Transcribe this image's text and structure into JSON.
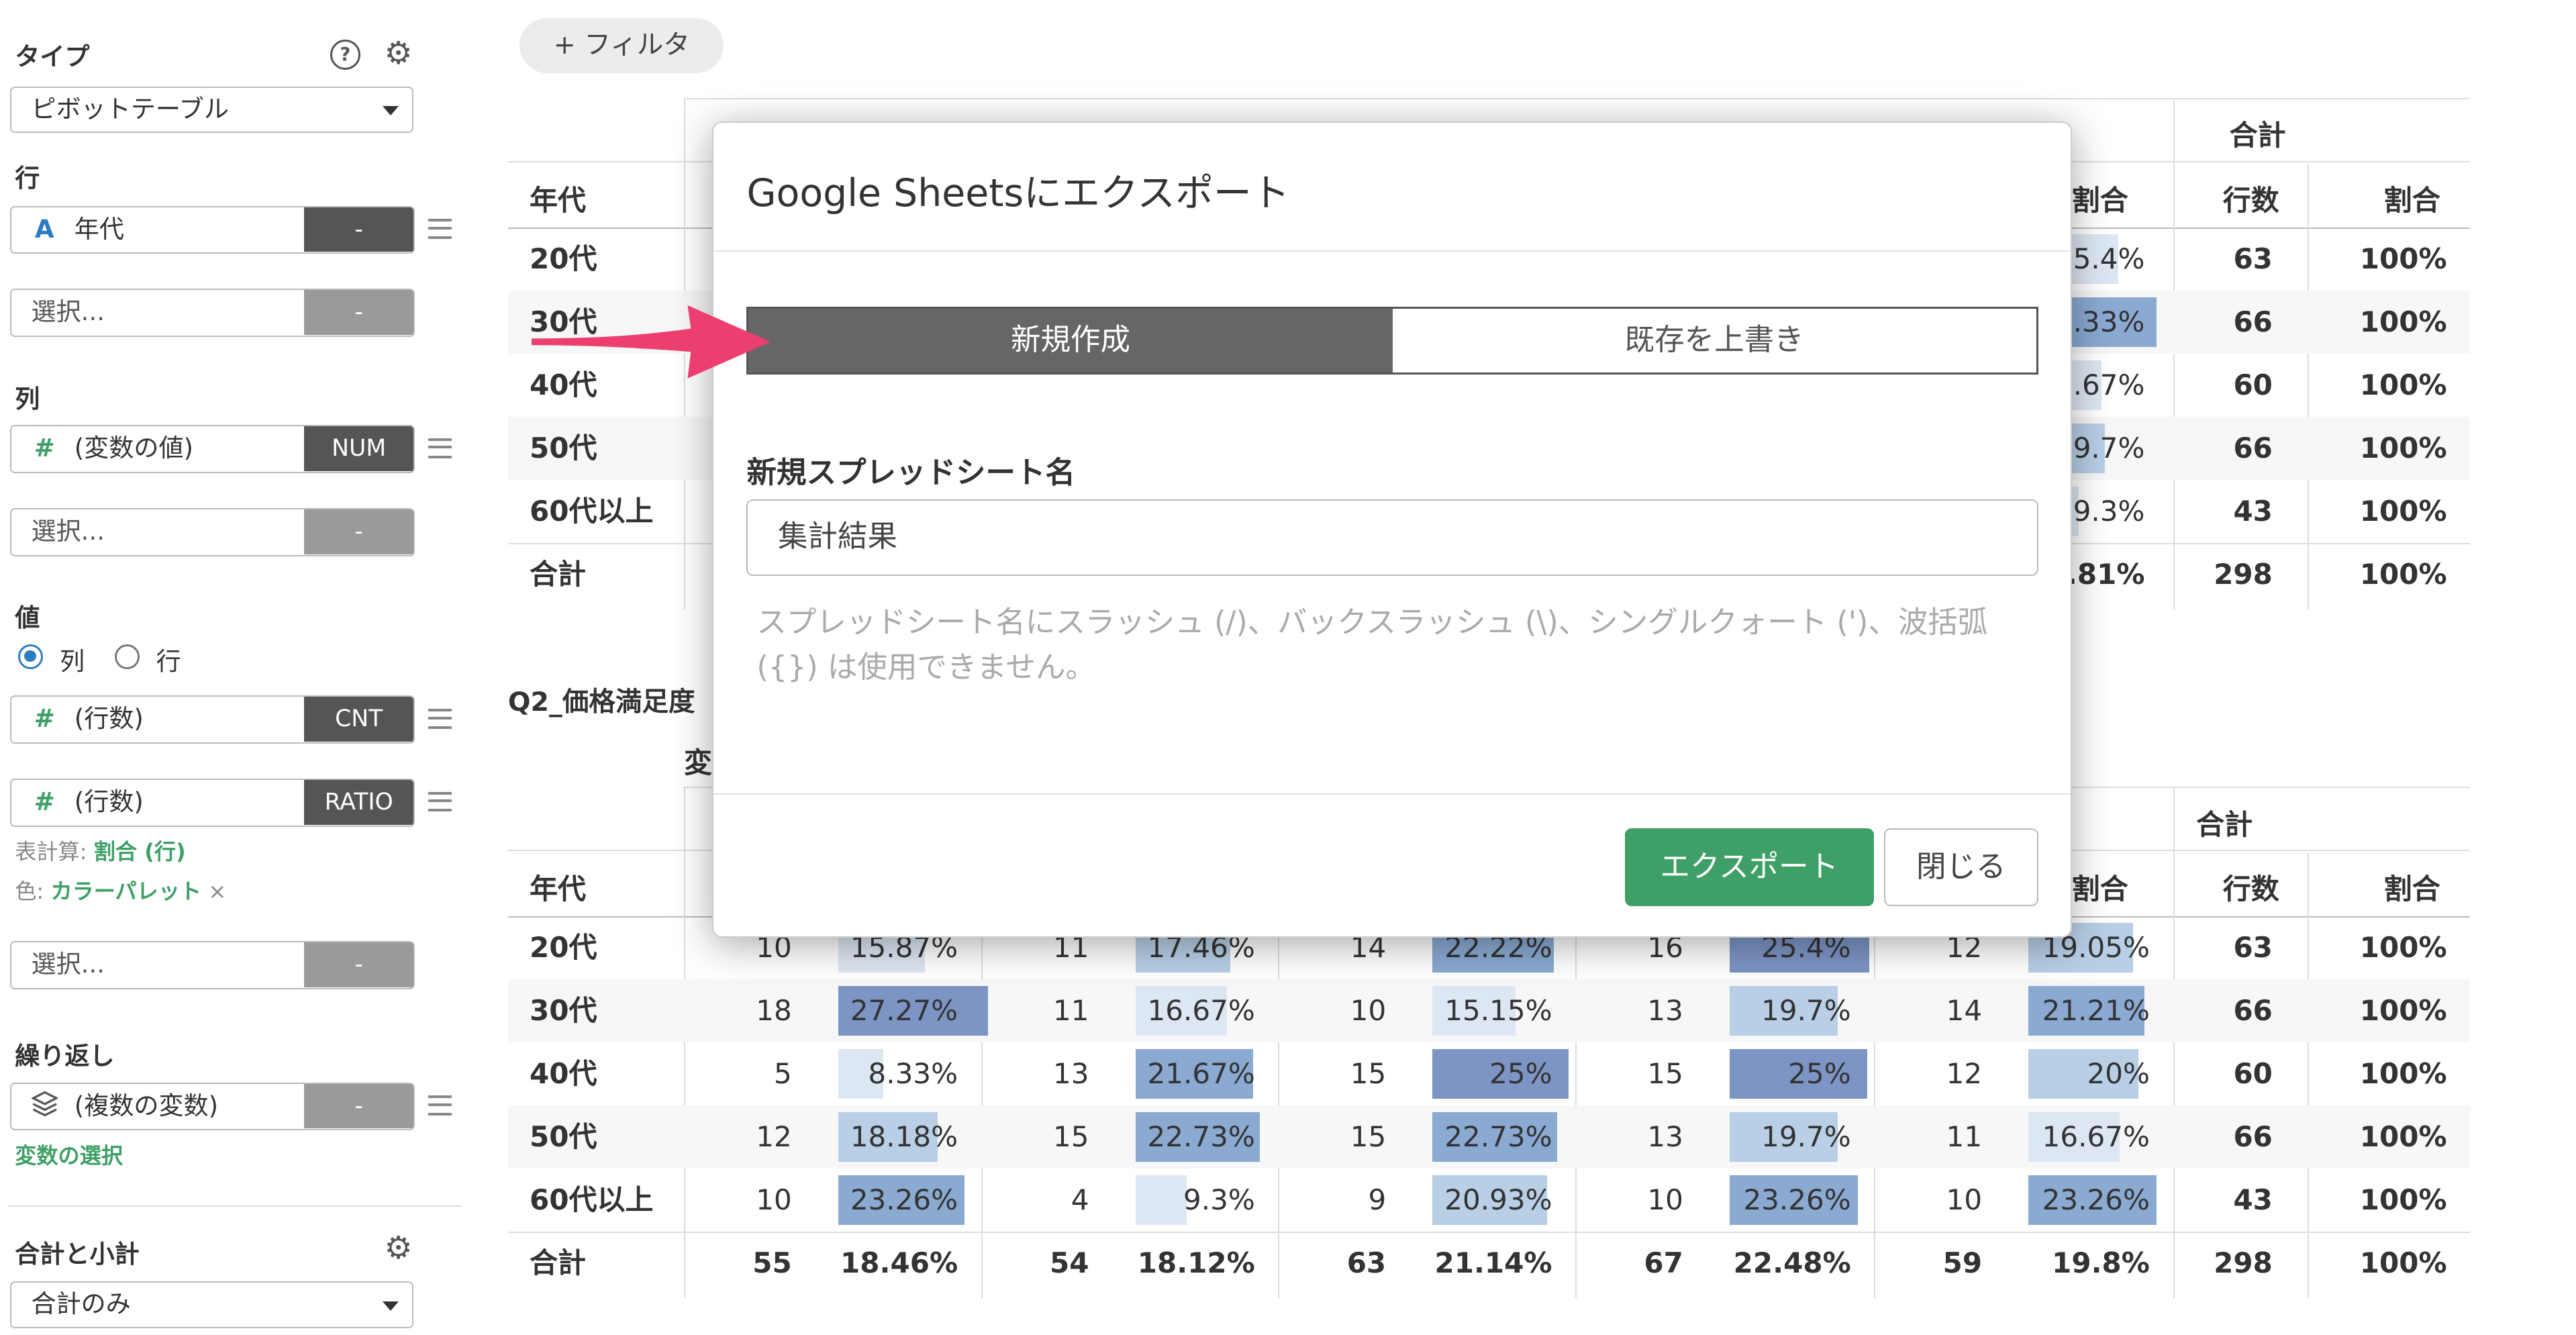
{
  "sidebar": {
    "type_label": "タイプ",
    "type_value": "ピボットテーブル",
    "row_label": "行",
    "row_field": {
      "type": "A",
      "name": "年代",
      "tag": "-"
    },
    "row_select": {
      "placeholder": "選択...",
      "tag": "-"
    },
    "col_label": "列",
    "col_field": {
      "type": "#",
      "name": "(変数の値)",
      "tag": "NUM"
    },
    "col_select": {
      "placeholder": "選択...",
      "tag": "-"
    },
    "value_label": "値",
    "radio_col": "列",
    "radio_row": "行",
    "value_field1": {
      "type": "#",
      "name": "(行数)",
      "tag": "CNT"
    },
    "value_field2": {
      "type": "#",
      "name": "(行数)",
      "tag": "RATIO"
    },
    "calc_note_prefix": "表計算:",
    "calc_note_value": "割合 (行)",
    "color_note_prefix": "色:",
    "color_note_value": "カラーパレット",
    "color_note_remove": "×",
    "value_select": {
      "placeholder": "選択...",
      "tag": "-"
    },
    "repeat_label": "繰り返し",
    "repeat_field": {
      "name": "(複数の変数)",
      "tag": "-"
    },
    "repeat_link": "変数の選択",
    "total_label": "合計と小計",
    "total_value": "合計のみ"
  },
  "main": {
    "filter_button": "+ フィルタ",
    "table1": {
      "total_header": "合計",
      "row_header": "年代",
      "ratio_header": "割合",
      "count_header": "行数",
      "visible_ratio_col": [
        "5.4%",
        ".33%",
        ".67%",
        "9.7%",
        "9.3%",
        ".81%"
      ],
      "rows": [
        {
          "label": "20代",
          "total_n": "63",
          "total_pct": "100%"
        },
        {
          "label": "30代",
          "total_n": "66",
          "total_pct": "100%"
        },
        {
          "label": "40代",
          "total_n": "60",
          "total_pct": "100%"
        },
        {
          "label": "50代",
          "total_n": "66",
          "total_pct": "100%"
        },
        {
          "label": "60代以上",
          "total_n": "43",
          "total_pct": "100%"
        },
        {
          "label": "合計",
          "total_n": "298",
          "total_pct": "100%"
        }
      ]
    },
    "table2_title": "Q2_価格満足度",
    "table2_var_label": "変",
    "table2": {
      "total_header": "合計",
      "row_header": "年代",
      "ratio_header": "割合",
      "count_header": "行数",
      "rows": [
        {
          "label": "20代",
          "c": [
            "10",
            "11",
            "14",
            "16",
            "12"
          ],
          "p": [
            "15.87%",
            "17.46%",
            "22.22%",
            "25.4%",
            "19.05%"
          ],
          "total_n": "63",
          "total_pct": "100%"
        },
        {
          "label": "30代",
          "c": [
            "18",
            "11",
            "10",
            "13",
            "14"
          ],
          "p": [
            "27.27%",
            "16.67%",
            "15.15%",
            "19.7%",
            "21.21%"
          ],
          "total_n": "66",
          "total_pct": "100%"
        },
        {
          "label": "40代",
          "c": [
            "5",
            "13",
            "15",
            "15",
            "12"
          ],
          "p": [
            "8.33%",
            "21.67%",
            "25%",
            "25%",
            "20%"
          ],
          "total_n": "60",
          "total_pct": "100%"
        },
        {
          "label": "50代",
          "c": [
            "12",
            "15",
            "15",
            "13",
            "11"
          ],
          "p": [
            "18.18%",
            "22.73%",
            "22.73%",
            "19.7%",
            "16.67%"
          ],
          "total_n": "66",
          "total_pct": "100%"
        },
        {
          "label": "60代以上",
          "c": [
            "10",
            "4",
            "9",
            "10",
            "10"
          ],
          "p": [
            "23.26%",
            "9.3%",
            "20.93%",
            "23.26%",
            "23.26%"
          ],
          "total_n": "43",
          "total_pct": "100%"
        },
        {
          "label": "合計",
          "c": [
            "55",
            "54",
            "63",
            "67",
            "59"
          ],
          "p": [
            "18.46%",
            "18.12%",
            "21.14%",
            "22.48%",
            "19.8%"
          ],
          "total_n": "298",
          "total_pct": "100%"
        }
      ]
    }
  },
  "modal": {
    "title": "Google Sheetsにエクスポート",
    "tab_new": "新規作成",
    "tab_overwrite": "既存を上書き",
    "name_label": "新規スプレッドシート名",
    "name_value": "集計結果",
    "help_text": "スプレッドシート名にスラッシュ (/)、バックスラッシュ (\\)、シングルクォート (')、波括弧 ({}) は使用できません。",
    "export_button": "エクスポート",
    "close_button": "閉じる"
  },
  "colors": {
    "accent_green": "#3fa067",
    "bar_scale": [
      "#dde7f3",
      "#b8cfe6",
      "#8aaad2",
      "#7d95c4"
    ],
    "arrow": "#ec3f70"
  }
}
